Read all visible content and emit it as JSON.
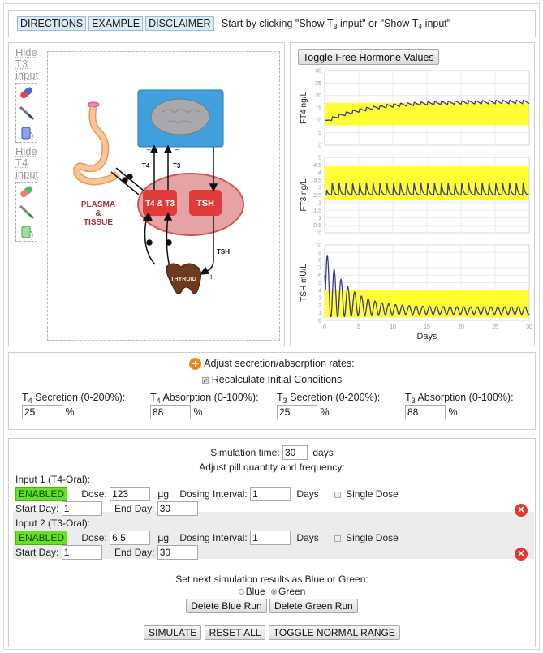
{
  "toolbar": {
    "directions_label": "DIRECTIONS",
    "example_label": "EXAMPLE",
    "disclaimer_label": "DISCLAIMER",
    "hint_prefix": "Start by clicking \"Show T",
    "hint_sub1": "3",
    "hint_mid": " input\" or \"Show T",
    "hint_sub2": "4",
    "hint_suffix": " input\""
  },
  "left_panel": {
    "hide_t3": [
      "Hide",
      "T3",
      "input"
    ],
    "hide_t4": [
      "Hide",
      "T4",
      "input"
    ],
    "t3_icons": [
      "pill-icon",
      "syringe-icon",
      "iv-bag-icon"
    ],
    "t4_icons": [
      "pill-icon",
      "syringe-icon",
      "iv-bag-icon"
    ],
    "diagram": {
      "plasma_label": [
        "PLASMA",
        "&",
        "TISSUE"
      ],
      "t4t3_label": "T4 & T3",
      "tsh_box_label": "TSH",
      "tsh_arrow_label": "TSH",
      "thyroid_label": "THYROID",
      "t4_arrow_label": "T4",
      "t3_arrow_label": "T3",
      "minus_sign": "–",
      "plus_sign": "+"
    }
  },
  "right_panel": {
    "toggle_label": "Toggle Free Hormone Values",
    "xlabel": "Days"
  },
  "chart_data": [
    {
      "type": "line",
      "title": "",
      "ylabel": "FT4 ng/L",
      "xlabel": "",
      "xlim": [
        0,
        30
      ],
      "ylim": [
        0,
        30
      ],
      "yticks": [
        0,
        5,
        10,
        15,
        20,
        25,
        30
      ],
      "xticks": [
        0,
        5,
        10,
        15,
        20,
        25,
        30
      ],
      "show_xtick_labels": false,
      "grid": true,
      "normal_range": [
        8,
        17
      ],
      "series": [
        {
          "name": "Green run (shown dark blue)",
          "color": "#3a3a8a",
          "baseline": 10,
          "start": 10,
          "end_mean": 17.5,
          "amplitude": 1.4,
          "period_days": 1,
          "rise_tau_days": 6
        }
      ]
    },
    {
      "type": "line",
      "title": "",
      "ylabel": "FT3 ng/L",
      "xlabel": "",
      "xlim": [
        0,
        30
      ],
      "ylim": [
        0,
        5
      ],
      "yticks": [
        0.0,
        0.5,
        1.0,
        1.5,
        2.0,
        2.5,
        3.0,
        3.5,
        4.0,
        4.5,
        5.0
      ],
      "xticks": [
        0,
        5,
        10,
        15,
        20,
        25,
        30
      ],
      "show_xtick_labels": false,
      "grid": true,
      "normal_range": [
        2.2,
        4.4
      ],
      "series": [
        {
          "name": "Green run (shown dark blue)",
          "color": "#3a3a8a",
          "trough": 2.5,
          "peak": 3.35,
          "period_days": 1
        }
      ]
    },
    {
      "type": "line",
      "title": "",
      "ylabel": "TSH mU/L",
      "xlabel": "Days",
      "xlim": [
        0,
        30
      ],
      "ylim": [
        0,
        10
      ],
      "yticks": [
        0,
        1,
        2,
        3,
        4,
        5,
        6,
        7,
        8,
        9,
        10
      ],
      "xticks": [
        0,
        5,
        10,
        15,
        20,
        25,
        30
      ],
      "show_xtick_labels": true,
      "grid": true,
      "normal_range": [
        0.4,
        4.0
      ],
      "series": [
        {
          "name": "Green run (shown dark blue)",
          "color": "#3a3a8a",
          "start": 6,
          "first_peak": 9,
          "final_mean": 1.3,
          "final_amplitude": 0.5,
          "period_days": 1
        }
      ]
    }
  ],
  "rates": {
    "header": "Adjust secretion/absorption rates:",
    "recalc_label": "Recalculate Initial Conditions",
    "recalc_checked": true,
    "fields": [
      {
        "hormone": "T",
        "sub": "4",
        "label": " Secretion (0-200%):",
        "value": "25",
        "unit": "%"
      },
      {
        "hormone": "T",
        "sub": "4",
        "label": " Absorption (0-100%):",
        "value": "88",
        "unit": "%"
      },
      {
        "hormone": "T",
        "sub": "3",
        "label": " Secretion (0-200%):",
        "value": "25",
        "unit": "%"
      },
      {
        "hormone": "T",
        "sub": "3",
        "label": " Absorption (0-100%):",
        "value": "88",
        "unit": "%"
      }
    ]
  },
  "simulation": {
    "time_label": "Simulation time:",
    "time_value": "30",
    "time_unit": "days",
    "adjust_label": "Adjust pill quantity and frequency:",
    "inputs": [
      {
        "title": "Input 1 (T4-Oral):",
        "status": "ENABLED",
        "dose_label": "Dose:",
        "dose": "123",
        "dose_unit": "µg",
        "interval_label": "Dosing Interval:",
        "interval": "1",
        "interval_unit": "Days",
        "single_dose_label": "Single Dose",
        "start_label": "Start Day:",
        "start": "1",
        "end_label": "End Day:",
        "end": "30"
      },
      {
        "title": "Input 2 (T3-Oral):",
        "status": "ENABLED",
        "dose_label": "Dose:",
        "dose": "6.5",
        "dose_unit": "µg",
        "interval_label": "Dosing Interval:",
        "interval": "1",
        "interval_unit": "Days",
        "single_dose_label": "Single Dose",
        "start_label": "Start Day:",
        "start": "1",
        "end_label": "End Day:",
        "end": "30"
      }
    ],
    "run_color_label": "Set next simulation results as Blue or Green:",
    "radio_blue": "Blue",
    "radio_green": "Green",
    "selected_run": "Green",
    "delete_blue": "Delete Blue Run",
    "delete_green": "Delete Green Run",
    "simulate": "SIMULATE",
    "reset": "RESET ALL",
    "toggle_range": "TOGGLE NORMAL RANGE"
  },
  "colors": {
    "normal_range": "#ffff33",
    "series_line": "#3a3a8a",
    "enabled_bg": "#66e020",
    "delete_icon": "#e03a2f",
    "brain_box": "#3fa0dd",
    "plasma_oval": "#e5a3a6",
    "hormone_box": "#e03a3a",
    "thyroid": "#6b3a1f"
  }
}
